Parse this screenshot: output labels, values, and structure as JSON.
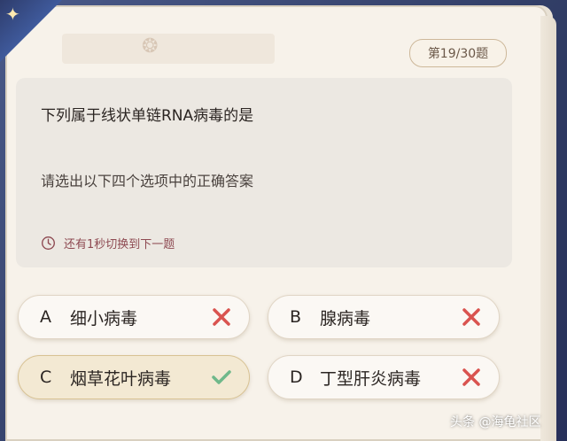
{
  "header": {
    "counter": "第19/30题"
  },
  "question": {
    "text": "下列属于线状单链RNA病毒的是",
    "instruction": "请选出以下四个选项中的正确答案",
    "timer_text": "还有1秒切换到下一题"
  },
  "options": [
    {
      "letter": "A",
      "text": "细小病毒",
      "state": "wrong"
    },
    {
      "letter": "B",
      "text": "腺病毒",
      "state": "wrong"
    },
    {
      "letter": "C",
      "text": "烟草花叶病毒",
      "state": "correct"
    },
    {
      "letter": "D",
      "text": "丁型肝炎病毒",
      "state": "wrong"
    }
  ],
  "watermark": "头条 @海龟社区",
  "colors": {
    "wrong_mark": "#d9534f",
    "correct_mark": "#6fb88a",
    "timer": "#8e4a52"
  }
}
